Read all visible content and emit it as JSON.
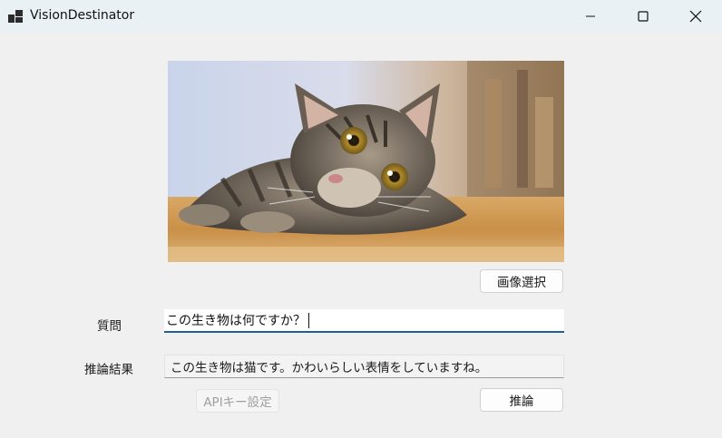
{
  "window": {
    "title": "VisionDestinator",
    "app_icon": "app-window-icon",
    "controls": [
      "minimize-icon",
      "maximize-icon",
      "close-icon"
    ]
  },
  "image_panel": {
    "content": "tabby-cat-photo"
  },
  "buttons": {
    "select_image": "画像選択",
    "api_key": "APIキー設定",
    "inference": "推論"
  },
  "question": {
    "label": "質問",
    "value": "この生き物は何ですか？"
  },
  "result": {
    "label": "推論結果",
    "value": "この生き物は猫です。かわいらしい表情をしていますね。"
  },
  "colors": {
    "titlebar": "#e9f1f5",
    "window_bg": "#f0f0f0",
    "input_accent": "#1f5f9b"
  }
}
